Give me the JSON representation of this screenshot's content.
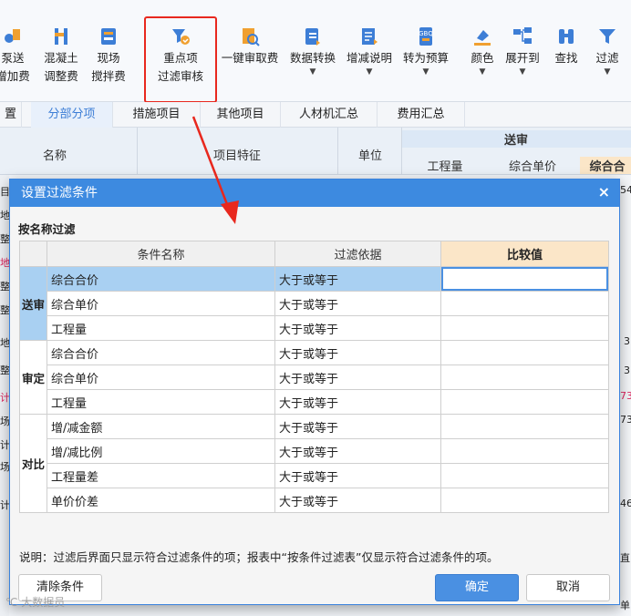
{
  "ribbon": {
    "buttons": [
      {
        "line1": "泵送",
        "line2": "增加费",
        "icon": "pump-icon"
      },
      {
        "line1": "混凝土",
        "line2": "调整费",
        "icon": "concrete-icon"
      },
      {
        "line1": "现场",
        "line2": "搅拌费",
        "icon": "mixer-icon"
      },
      {
        "line1": "重点项",
        "line2": "过滤审核",
        "icon": "key-filter-icon"
      },
      {
        "line1": "一键审取费",
        "line2": "",
        "icon": "fee-review-icon"
      },
      {
        "line1": "数据转换",
        "line2": "",
        "icon": "data-convert-icon"
      },
      {
        "line1": "增减说明",
        "line2": "",
        "icon": "change-note-icon"
      },
      {
        "line1": "转为预算",
        "line2": "",
        "icon": "to-budget-icon"
      },
      {
        "line1": "颜色",
        "line2": "",
        "icon": "color-icon"
      },
      {
        "line1": "展开到",
        "line2": "",
        "icon": "expand-icon"
      },
      {
        "line1": "查找",
        "line2": "",
        "icon": "binoculars-icon"
      },
      {
        "line1": "过滤",
        "line2": "",
        "icon": "funnel-icon"
      }
    ]
  },
  "tabs": [
    "置",
    "分部分项",
    "措施项目",
    "其他项目",
    "人材机汇总",
    "费用汇总"
  ],
  "grid_header": {
    "name": "名称",
    "features": "项目特征",
    "unit": "单位",
    "submit": "送审",
    "quantity": "工程量",
    "unit_price": "综合单价",
    "total": "综合合"
  },
  "edges": {
    "left": [
      "目",
      "地",
      "整",
      "地",
      "整",
      "整",
      "地",
      "整",
      "计",
      "场",
      "计",
      "场",
      "计"
    ],
    "right": [
      "54",
      "3",
      "3",
      "73",
      "73",
      "46"
    ],
    "bottom_right": [
      "直",
      "单"
    ]
  },
  "dialog": {
    "title": "设置过滤条件",
    "section": "按名称过滤",
    "headers": {
      "name": "条件名称",
      "basis": "过滤依据",
      "compare": "比较值"
    },
    "groups": [
      {
        "label": "送审",
        "rows": [
          {
            "name": "综合合价",
            "basis": "大于或等于",
            "value": ""
          },
          {
            "name": "综合单价",
            "basis": "大于或等于",
            "value": ""
          },
          {
            "name": "工程量",
            "basis": "大于或等于",
            "value": ""
          }
        ]
      },
      {
        "label": "审定",
        "rows": [
          {
            "name": "综合合价",
            "basis": "大于或等于",
            "value": ""
          },
          {
            "name": "综合单价",
            "basis": "大于或等于",
            "value": ""
          },
          {
            "name": "工程量",
            "basis": "大于或等于",
            "value": ""
          }
        ]
      },
      {
        "label": "对比",
        "rows": [
          {
            "name": "增/减金额",
            "basis": "大于或等于",
            "value": ""
          },
          {
            "name": "增/减比例",
            "basis": "大于或等于",
            "value": ""
          },
          {
            "name": "工程量差",
            "basis": "大于或等于",
            "value": ""
          },
          {
            "name": "单价价差",
            "basis": "大于或等于",
            "value": ""
          }
        ]
      }
    ],
    "note": "说明：过滤后界面只显示符合过滤条件的项；报表中“按条件过滤表”仅显示符合过滤条件的项。",
    "clear_button": "清除条件",
    "ok_button": "确定",
    "cancel_button": "取消",
    "close_glyph": "×"
  },
  "watermark": "℃ 大数据员",
  "colors": {
    "accent": "#3d8ae0",
    "highlight": "#e8281e",
    "selection": "#a9d0f2"
  }
}
